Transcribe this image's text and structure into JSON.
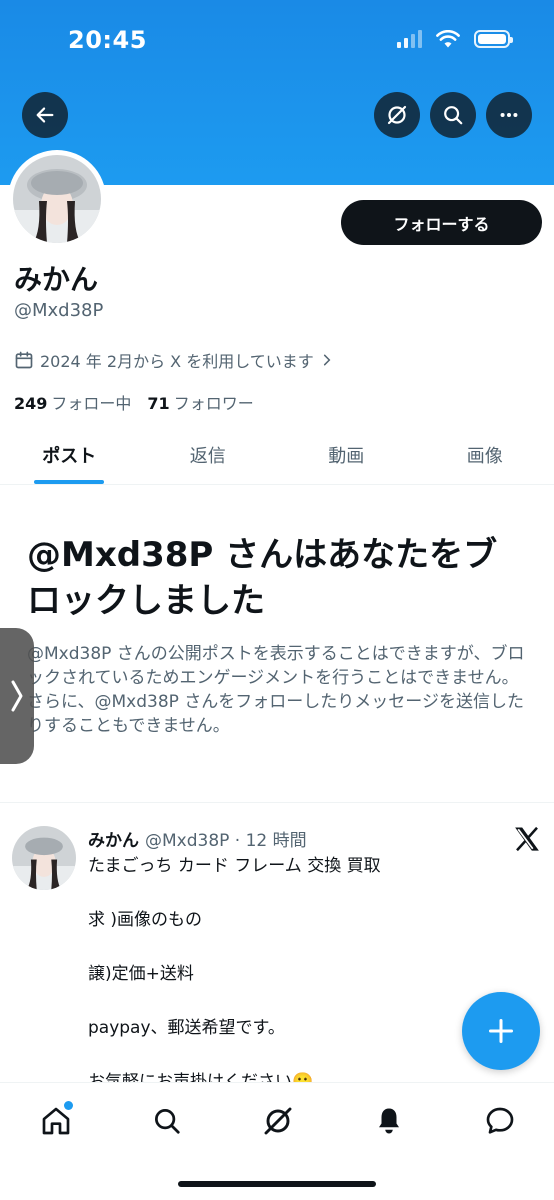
{
  "status_bar": {
    "time": "20:45"
  },
  "header": {
    "back_icon": "arrow-left-icon",
    "grok_icon": "grok-icon",
    "search_icon": "search-icon",
    "more_icon": "more-icon"
  },
  "profile": {
    "follow_label": "フォローする",
    "display_name": "みかん",
    "handle": "@Mxd38P",
    "joined": "2024 年 2月から X を利用しています",
    "following_count": "249",
    "following_label": "フォロー中",
    "followers_count": "71",
    "followers_label": "フォロワー"
  },
  "tabs": [
    {
      "label": "ポスト",
      "active": true
    },
    {
      "label": "返信",
      "active": false
    },
    {
      "label": "動画",
      "active": false
    },
    {
      "label": "画像",
      "active": false
    }
  ],
  "blocked": {
    "title": "@Mxd38P さんはあなたをブロックしました",
    "description": "@Mxd38P さんの公開ポストを表示することはできますが、ブロックされているためエンゲージメントを行うことはできません。さらに、@Mxd38P さんをフォローしたりメッセージを送信したりすることもできません。"
  },
  "post": {
    "name": "みかん",
    "handle_time": "@Mxd38P · 12 時間",
    "lines": [
      "たまごっち カード フレーム 交換 買取",
      "求 )画像のもの",
      "譲)定価+送料",
      "paypay、郵送希望です。",
      "お気軽にお声掛けください🙂"
    ]
  },
  "colors": {
    "accent": "#1d9bf0",
    "banner": "#1d9bf0",
    "text": "#0f1419",
    "muted": "#536471"
  }
}
